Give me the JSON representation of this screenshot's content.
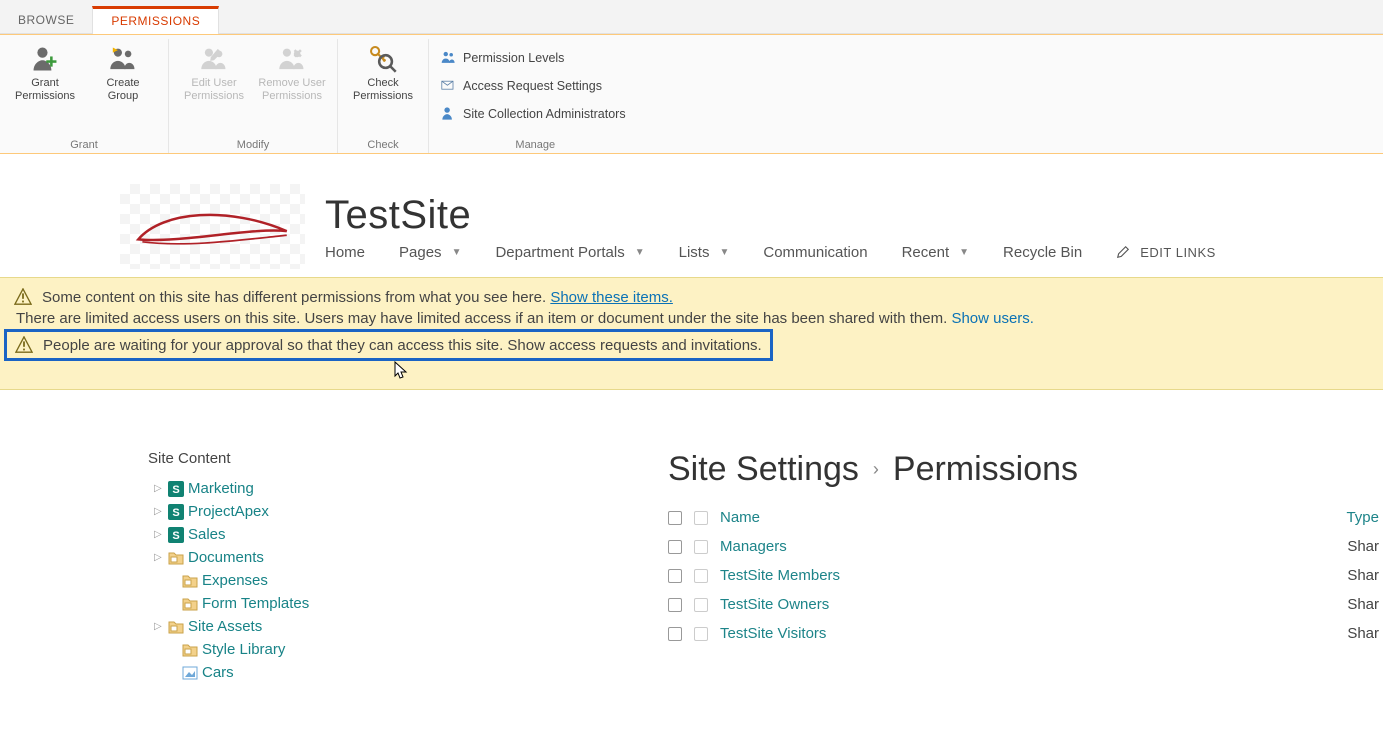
{
  "tabs": {
    "browse": "BROWSE",
    "permissions": "PERMISSIONS"
  },
  "ribbon": {
    "grant": {
      "group_label": "Grant",
      "grant_perm": "Grant\nPermissions",
      "create_group": "Create\nGroup"
    },
    "modify": {
      "group_label": "Modify",
      "edit_user": "Edit User\nPermissions",
      "remove_user": "Remove User\nPermissions"
    },
    "check": {
      "group_label": "Check",
      "check_perm": "Check\nPermissions"
    },
    "manage": {
      "group_label": "Manage",
      "perm_levels": "Permission Levels",
      "access_req": "Access Request Settings",
      "site_admins": "Site Collection Administrators"
    }
  },
  "site_title": "TestSite",
  "top_nav": {
    "home": "Home",
    "pages": "Pages",
    "dept": "Department Portals",
    "lists": "Lists",
    "comm": "Communication",
    "recent": "Recent",
    "recycle": "Recycle Bin",
    "edit_links": "EDIT LINKS"
  },
  "notifications": {
    "line1_text": "Some content on this site has different permissions from what you see here.  ",
    "line1_link": "Show these items.",
    "line2_text": "There are limited access users on this site. Users may have limited access if an item or document under the site has been shared with them. ",
    "line2_link": "Show users.",
    "line3_text": "People are waiting for your approval so that they can access this site. ",
    "line3_link": "Show access requests and invitations."
  },
  "sidebar": {
    "heading": "Site Content",
    "items": [
      {
        "label": "Marketing",
        "icon": "sp-site",
        "expandable": true,
        "indent": false
      },
      {
        "label": "ProjectApex",
        "icon": "sp-site",
        "expandable": true,
        "indent": false
      },
      {
        "label": "Sales",
        "icon": "sp-site",
        "expandable": true,
        "indent": false
      },
      {
        "label": "Documents",
        "icon": "doclib",
        "expandable": true,
        "indent": false
      },
      {
        "label": "Expenses",
        "icon": "doclib",
        "expandable": false,
        "indent": true
      },
      {
        "label": "Form Templates",
        "icon": "doclib",
        "expandable": false,
        "indent": true
      },
      {
        "label": "Site Assets",
        "icon": "doclib",
        "expandable": true,
        "indent": false
      },
      {
        "label": "Style Library",
        "icon": "doclib",
        "expandable": false,
        "indent": true
      },
      {
        "label": "Cars",
        "icon": "piclib",
        "expandable": false,
        "indent": true
      }
    ]
  },
  "breadcrumb": {
    "a": "Site Settings",
    "b": "Permissions"
  },
  "perm_table": {
    "col_name": "Name",
    "col_type": "Type",
    "rows": [
      {
        "name": "Managers",
        "type": "Shar"
      },
      {
        "name": "TestSite Members",
        "type": "Shar"
      },
      {
        "name": "TestSite Owners",
        "type": "Shar"
      },
      {
        "name": "TestSite Visitors",
        "type": "Shar"
      }
    ]
  }
}
